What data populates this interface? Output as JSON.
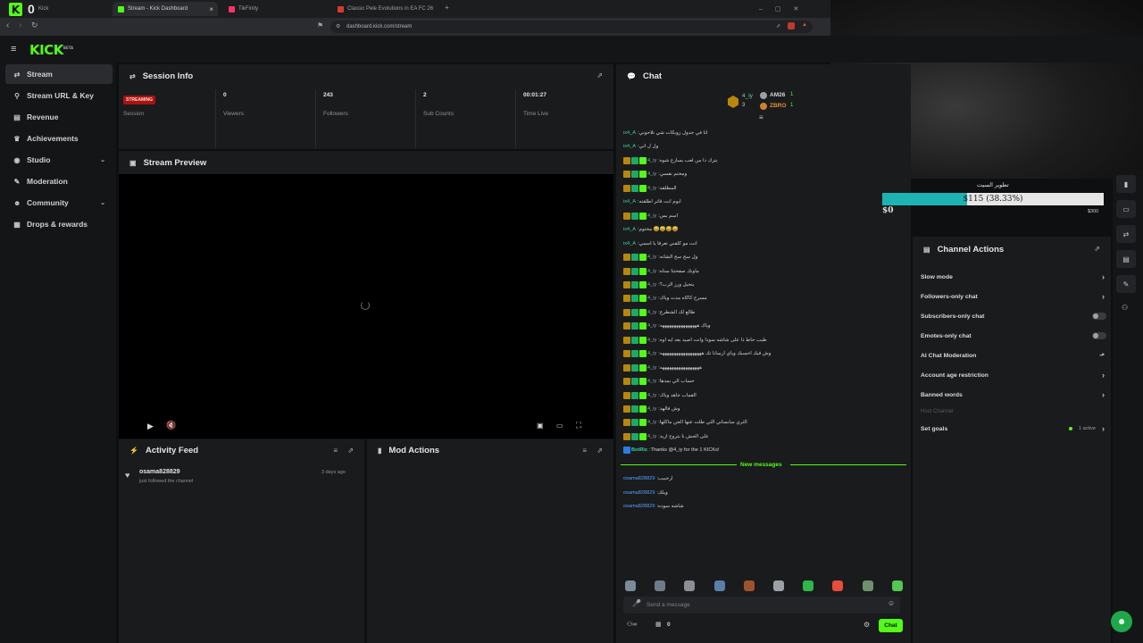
{
  "browser": {
    "tabs": [
      {
        "label": "Kick",
        "fav": "#53fc18"
      },
      {
        "label": "Stream - Kick Dashboard",
        "fav": "#53fc18"
      },
      {
        "label": "TikFinity",
        "fav": "#ff3366"
      },
      {
        "label": "Classic Pele Evolutions in EA FC 26",
        "fav": "#d63a2f"
      }
    ],
    "new_tab": "+",
    "url": "dashboard.kick.com/stream",
    "top_left_counter": "0"
  },
  "app": {
    "logo": "KICK",
    "logo_beta": "BETA"
  },
  "sidebar": {
    "items": [
      {
        "label": "Stream",
        "icon": "stream-icon",
        "glyph": "⇄"
      },
      {
        "label": "Stream URL & Key",
        "icon": "link-icon",
        "glyph": "⚲"
      },
      {
        "label": "Revenue",
        "icon": "wallet-icon",
        "glyph": "▤"
      },
      {
        "label": "Achievements",
        "icon": "trophy-icon",
        "glyph": "♛"
      },
      {
        "label": "Studio",
        "icon": "studio-icon",
        "glyph": "◉"
      },
      {
        "label": "Moderation",
        "icon": "hammer-icon",
        "glyph": "✎"
      },
      {
        "label": "Community",
        "icon": "community-icon",
        "glyph": "☻"
      },
      {
        "label": "Drops & rewards",
        "icon": "gift-icon",
        "glyph": "▦"
      }
    ]
  },
  "session": {
    "title": "Session Info",
    "status_badge": "STREAMING",
    "stats": [
      {
        "value": "",
        "label": "Session"
      },
      {
        "value": "0",
        "label": "Viewers"
      },
      {
        "value": "243",
        "label": "Followers"
      },
      {
        "value": "2",
        "label": "Sub Counts"
      },
      {
        "value": "00:01:27",
        "label": "Time Live"
      }
    ]
  },
  "preview": {
    "title": "Stream Preview"
  },
  "activity": {
    "title": "Activity Feed",
    "items": [
      {
        "user": "osama828829",
        "text": "just followed the channel",
        "time": "3 days ago"
      }
    ]
  },
  "mod_actions": {
    "title": "Mod Actions"
  },
  "chat": {
    "title": "Chat",
    "top_users": [
      {
        "name": "4_iy",
        "count": "3"
      },
      {
        "name": "AM26",
        "count": "1"
      },
      {
        "name": "ZBRO",
        "count": "1"
      }
    ],
    "messages": [
      {
        "user": "ix4_A",
        "text": "انا في جدول زوبكات شي تلاحوني",
        "badges": 0
      },
      {
        "user": "ix4_A",
        "text": "ول ل اني",
        "badges": 0
      },
      {
        "user": "4_iy",
        "text": "يترك ذا من لعب يسارع شوه",
        "badges": 3
      },
      {
        "user": "4_iy",
        "text": "ومحتم نفسي",
        "badges": 3
      },
      {
        "user": "4_iy",
        "text": "المطلقه",
        "badges": 3
      },
      {
        "user": "ix4_A",
        "text": "ابوم انت قاتر اطلقته",
        "badges": 0
      },
      {
        "user": "4_iy",
        "text": "اسم بس",
        "badges": 3
      },
      {
        "user": "ix4_A",
        "text": "مختوم 😅😅😅😅",
        "badges": 0
      },
      {
        "user": "ix4_A",
        "text": "انت مو كلفني تعرفا يا اسمي",
        "badges": 0
      },
      {
        "user": "4_iy",
        "text": "ول سح سح الشاته",
        "badges": 3
      },
      {
        "user": "4_iy",
        "text": "ماوبك صفحتنا ستاه",
        "badges": 3
      },
      {
        "user": "4_iy",
        "text": "يتحيل ورز الزب؟",
        "badges": 3
      },
      {
        "user": "4_iy",
        "text": "مسرح كاكاه مدت وياك",
        "badges": 3
      },
      {
        "user": "4_iy",
        "text": "طالع لك الشطرع",
        "badges": 3
      },
      {
        "user": "4_iy",
        "text": "وياك ههههههههههههههههه",
        "badges": 3
      },
      {
        "user": "4_iy",
        "text": "طيب حاط ذا على شاشه سودا وانت اصيد بعد ايه اوه",
        "badges": 3
      },
      {
        "user": "4_iy",
        "text": "وش فيك احسبك وياي ارسانا تك ههههههههههههههههههه",
        "badges": 3
      },
      {
        "user": "4_iy",
        "text": "هههههههههههههههههه",
        "badges": 3
      },
      {
        "user": "4_iy",
        "text": "حساب الي بمدها",
        "badges": 3
      },
      {
        "user": "4_iy",
        "text": "القماب جاهد وياك",
        "badges": 3
      },
      {
        "user": "4_iy",
        "text": "وش فالهد",
        "badges": 3
      },
      {
        "user": "4_iy",
        "text": "الثري سابساني الثي طلت عنها الجن ماكلها",
        "badges": 3
      },
      {
        "user": "4_iy",
        "text": "على الحش نا بتروح ازيد",
        "badges": 3
      },
      {
        "user": "BotRix",
        "text": "Thanks @4_iy for the 1 KICKs!",
        "badges": 1
      }
    ],
    "new_messages_label": "New messages",
    "new_messages": [
      {
        "user": "osama828829",
        "text": "ارحبيب"
      },
      {
        "user": "osama828829",
        "text": "ويلك"
      },
      {
        "user": "osama828829",
        "text": "شاشه سوده"
      }
    ],
    "input_placeholder": "Send a message",
    "viewer_count": "0",
    "send_label": "Chat"
  },
  "goal": {
    "title": "تطوير السيت",
    "current": "$115 (38.33%)",
    "progress": 0.3833,
    "min": "$0",
    "max": "$300"
  },
  "channel_actions": {
    "title": "Channel Actions",
    "rows": [
      {
        "label": "Slow mode",
        "ctrl": "arrow"
      },
      {
        "label": "Followers-only chat",
        "ctrl": "arrow"
      },
      {
        "label": "Subscribers-only chat",
        "ctrl": "toggle"
      },
      {
        "label": "Emotes-only chat",
        "ctrl": "toggle"
      },
      {
        "label": "AI Chat Moderation",
        "ctrl": "chart"
      },
      {
        "label": "Account age restriction",
        "ctrl": "arrow"
      },
      {
        "label": "Banned words",
        "ctrl": "arrow"
      },
      {
        "label": "Host Channel",
        "ctrl": "none"
      },
      {
        "label": "Set goals",
        "ctrl": "active"
      }
    ],
    "active_label": "1 active"
  },
  "colors": {
    "accent": "#53fc18",
    "live": "#a8130f",
    "progress": "#1fb2b2"
  }
}
